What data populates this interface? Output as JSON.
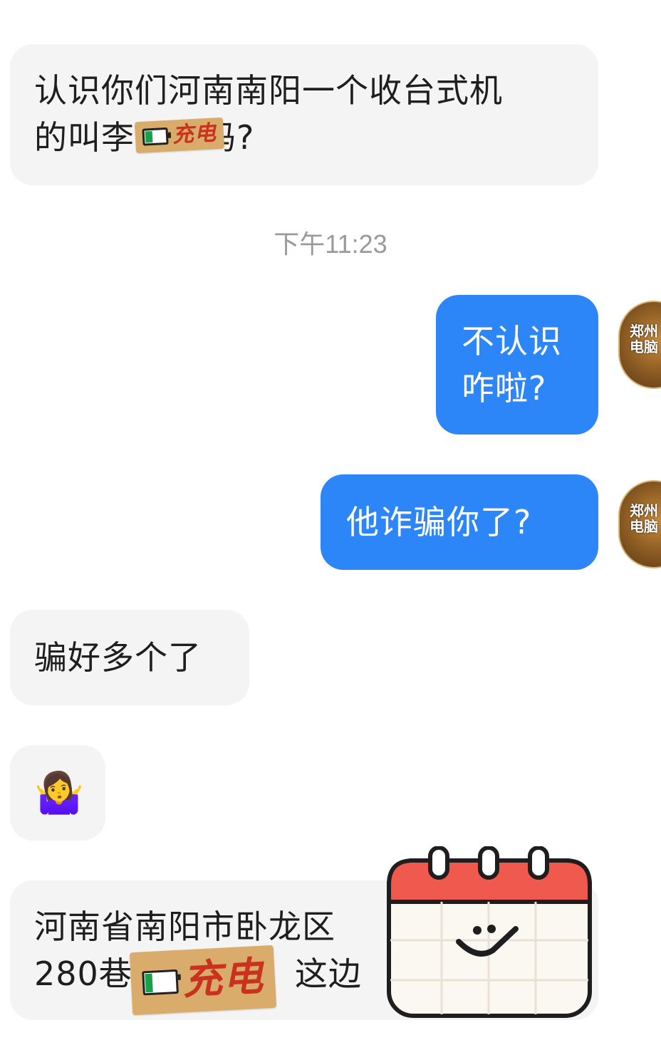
{
  "messages": [
    {
      "id": "m1",
      "side": "in",
      "lines": [
        "认识你们河南南阳一个收台式机",
        "的叫李",
        "吗?"
      ]
    },
    {
      "id": "t1",
      "type": "time",
      "text": "下午11:23"
    },
    {
      "id": "m2",
      "side": "out",
      "lines": [
        "不认识",
        "咋啦?"
      ]
    },
    {
      "id": "m3",
      "side": "out",
      "lines": [
        "他诈骗你了?"
      ]
    },
    {
      "id": "m4",
      "side": "in",
      "lines": [
        "骗好多个了"
      ]
    },
    {
      "id": "m5",
      "side": "in",
      "emoji": "🤷‍♀️"
    },
    {
      "id": "m6",
      "side": "in",
      "lines": [
        "河南省南阳市卧龙区",
        "280巷",
        "这边"
      ]
    }
  ],
  "mosaic": {
    "label": "充电"
  },
  "avatar": {
    "text": "郑州\n电脑"
  },
  "sticker": {
    "icon": "calendar-smile-icon",
    "colors": {
      "header": "#f05a4e",
      "outline": "#1e1e1e",
      "body": "#fbf8f2"
    }
  },
  "colors": {
    "outgoing": "#2d86f7",
    "incoming": "#f4f4f5",
    "timestamp": "#9a9a9a"
  }
}
